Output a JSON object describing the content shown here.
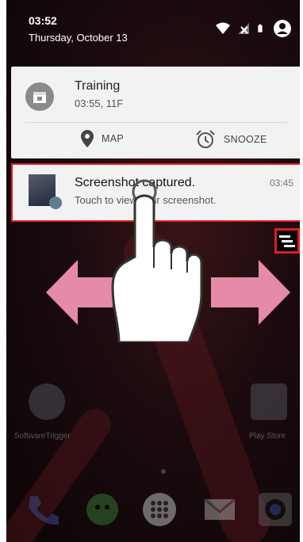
{
  "status_bar": {
    "time": "03:52",
    "date": "Thursday, October 13",
    "icons": [
      "wifi-icon",
      "no-signal-icon",
      "battery-icon",
      "account-icon"
    ]
  },
  "notifications": [
    {
      "app_icon": "calendar-icon",
      "title": "Training",
      "subtitle": "03:55, 11F",
      "actions": [
        {
          "icon": "location-pin-icon",
          "label": "MAP"
        },
        {
          "icon": "alarm-clock-icon",
          "label": "SNOOZE"
        }
      ]
    },
    {
      "app_icon": "screenshot-thumbnail",
      "title": "Screenshot captured.",
      "subtitle": "Touch to view your screenshot.",
      "time": "03:45"
    }
  ],
  "clear_all": {
    "icon": "clear-all-icon"
  },
  "gesture_overlay": {
    "icons": [
      "swipe-left-arrow",
      "swipe-right-arrow",
      "hand-touch-icon"
    ]
  },
  "home_apps": [
    {
      "label": "SoftwareTrigger",
      "icon": "barcode-icon"
    },
    {
      "label": "Play Store",
      "icon": "play-store-icon"
    }
  ],
  "dock": [
    "phone-icon",
    "hangouts-icon",
    "apps-icon",
    "email-icon",
    "camera-icon"
  ],
  "colors": {
    "highlight": "#e31b23",
    "arrow": "#e58aa8",
    "card": "#f2f2f2"
  }
}
